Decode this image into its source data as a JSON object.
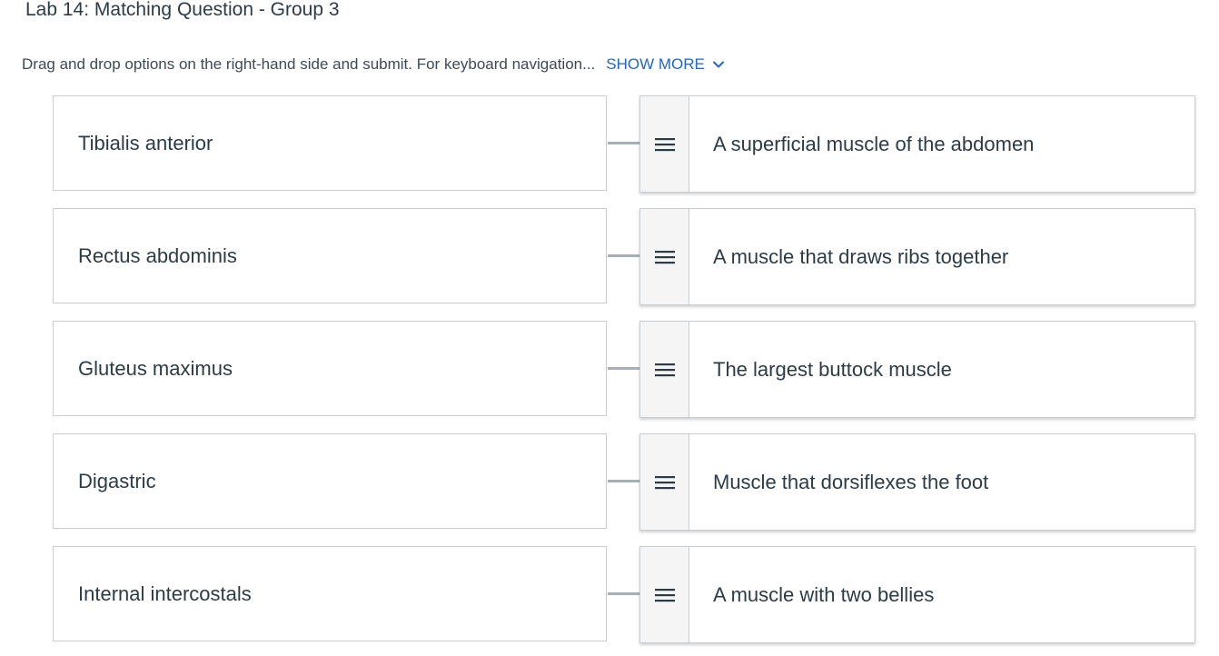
{
  "page": {
    "title": "Lab 14: Matching Question - Group 3",
    "instructions": "Drag and drop options on the right-hand side and submit. For keyboard navigation...",
    "show_more_label": "SHOW MORE"
  },
  "icons": {
    "show_more": "chevron-down-icon",
    "drag_handle": "hamburger-icon"
  },
  "colors": {
    "link": "#2167c6",
    "text": "#2d3b45",
    "border": "#c7cdd1",
    "connector": "#a5afb5",
    "handle_bg": "#f5f5f5"
  },
  "matches": [
    {
      "prompt": "Tibialis anterior",
      "answer": "A superficial muscle of the abdomen"
    },
    {
      "prompt": "Rectus abdominis",
      "answer": "A muscle that draws ribs together"
    },
    {
      "prompt": "Gluteus maximus",
      "answer": "The largest buttock muscle"
    },
    {
      "prompt": "Digastric",
      "answer": "Muscle that dorsiflexes the foot"
    },
    {
      "prompt": "Internal intercostals",
      "answer": "A muscle with two bellies"
    }
  ]
}
